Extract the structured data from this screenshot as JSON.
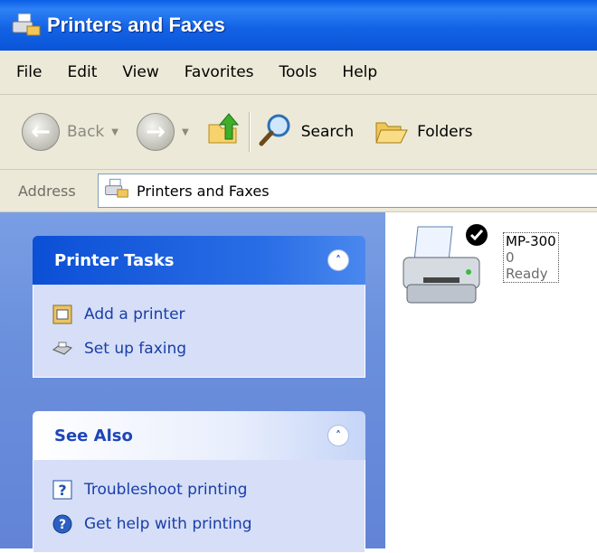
{
  "window": {
    "title": "Printers and Faxes",
    "icon": "printers-folder-icon"
  },
  "menu": {
    "items": [
      "File",
      "Edit",
      "View",
      "Favorites",
      "Tools",
      "Help"
    ]
  },
  "toolbar": {
    "back_label": "Back",
    "search_label": "Search",
    "folders_label": "Folders",
    "icons": [
      "back-arrow-icon",
      "forward-arrow-icon",
      "up-folder-icon",
      "search-icon",
      "folders-icon"
    ]
  },
  "address": {
    "label": "Address",
    "value": "Printers and Faxes"
  },
  "tasks": {
    "printer_tasks": {
      "title": "Printer Tasks",
      "items": [
        {
          "label": "Add a printer",
          "icon": "add-printer-icon"
        },
        {
          "label": "Set up faxing",
          "icon": "fax-icon"
        }
      ]
    },
    "see_also": {
      "title": "See Also",
      "items": [
        {
          "label": "Troubleshoot printing",
          "icon": "help-question-icon"
        },
        {
          "label": "Get help with printing",
          "icon": "help-circle-icon"
        }
      ]
    }
  },
  "printers": [
    {
      "name": "MP-300",
      "documents": "0",
      "status": "Ready",
      "default": true
    }
  ],
  "colors": {
    "titlebar": "#0b54d8",
    "taskpane": "#6a8fdc",
    "link": "#1a3da8",
    "chrome": "#ece9d8"
  }
}
